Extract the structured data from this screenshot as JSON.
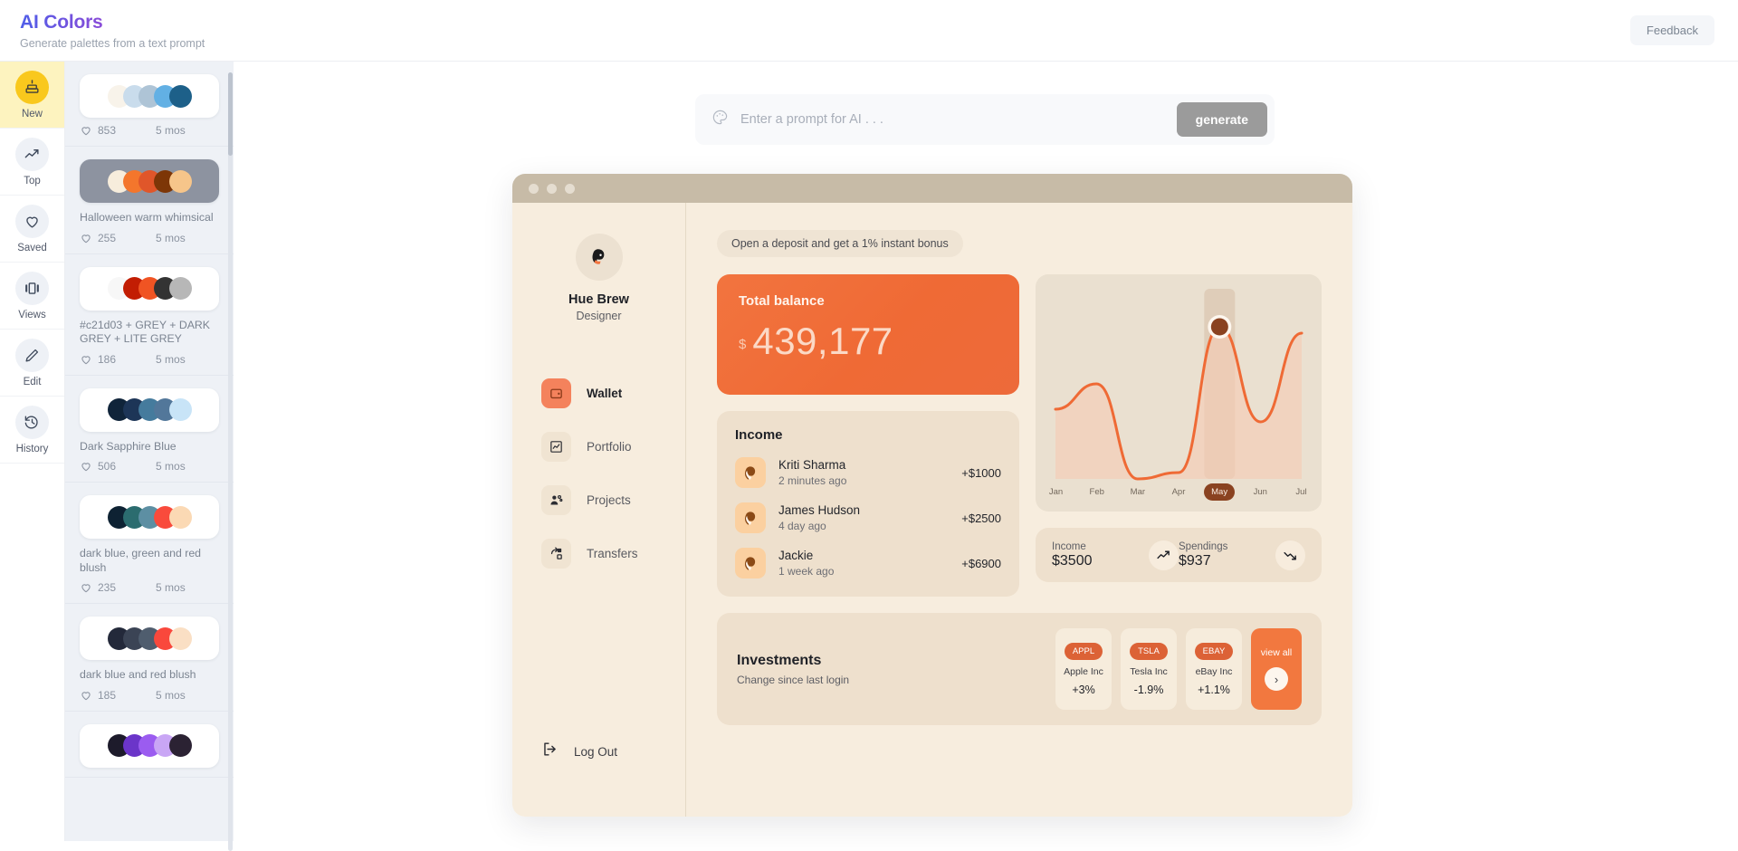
{
  "header": {
    "title": "AI Colors",
    "subtitle": "Generate palettes from a text prompt",
    "feedback_label": "Feedback"
  },
  "rail": {
    "items": [
      {
        "label": "New",
        "icon": "cake-icon",
        "active": true
      },
      {
        "label": "Top",
        "icon": "trending-up-icon",
        "active": false
      },
      {
        "label": "Saved",
        "icon": "heart-icon",
        "active": false
      },
      {
        "label": "Views",
        "icon": "carousel-icon",
        "active": false
      },
      {
        "label": "Edit",
        "icon": "pencil-icon",
        "active": false
      },
      {
        "label": "History",
        "icon": "history-icon",
        "active": false
      }
    ]
  },
  "palettes": {
    "items": [
      {
        "name": "",
        "likes": "853",
        "age": "5 mos",
        "card_dark": false,
        "colors": [
          "#f8f3ea",
          "#c9dcec",
          "#aec4d6",
          "#62b0e4",
          "#1d6089"
        ]
      },
      {
        "name": "Halloween warm whimsical",
        "likes": "255",
        "age": "5 mos",
        "card_dark": true,
        "colors": [
          "#f7eddc",
          "#f4762c",
          "#e0562a",
          "#7d3607",
          "#f6c58a"
        ]
      },
      {
        "name": "#c21d03 + GREY + DARK GREY + LITE GREY",
        "likes": "186",
        "age": "5 mos",
        "card_dark": false,
        "colors": [
          "#f7f7f7",
          "#c21d03",
          "#f05423",
          "#333333",
          "#b7b7b7"
        ]
      },
      {
        "name": "Dark Sapphire Blue",
        "likes": "506",
        "age": "5 mos",
        "card_dark": false,
        "colors": [
          "#10243a",
          "#1d3557",
          "#457b9d",
          "#52779a",
          "#c8e4f7"
        ]
      },
      {
        "name": "dark blue, green and red blush",
        "likes": "235",
        "age": "5 mos",
        "card_dark": false,
        "colors": [
          "#0e2233",
          "#2b6c6f",
          "#5d8fa3",
          "#f94b3c",
          "#fbd9b4"
        ]
      },
      {
        "name": "dark blue and red blush",
        "likes": "185",
        "age": "5 mos",
        "card_dark": false,
        "colors": [
          "#23293a",
          "#3b4455",
          "#4f5d6e",
          "#f9483c",
          "#fadfc4"
        ]
      },
      {
        "name": "",
        "likes": "",
        "age": "",
        "card_dark": false,
        "colors": [
          "#1d1b2b",
          "#6b35c9",
          "#9b5cf0",
          "#c9a6f5",
          "#2b2233"
        ]
      }
    ]
  },
  "prompt": {
    "placeholder": "Enter a prompt for AI . . .",
    "value": "",
    "icon": "palette-icon",
    "generate_label": "generate"
  },
  "preview": {
    "window_dots": 3,
    "user": {
      "name": "Hue Brew",
      "role": "Designer",
      "avatar": "user-avatar"
    },
    "nav": [
      {
        "label": "Wallet",
        "icon": "wallet-icon",
        "active": true
      },
      {
        "label": "Portfolio",
        "icon": "portfolio-icon",
        "active": false
      },
      {
        "label": "Projects",
        "icon": "projects-icon",
        "active": false
      },
      {
        "label": "Transfers",
        "icon": "transfers-icon",
        "active": false
      }
    ],
    "logout_label": "Log Out",
    "banner": "Open a deposit and get a 1% instant bonus",
    "balance": {
      "label": "Total balance",
      "currency": "$",
      "value": "439,177"
    },
    "income": {
      "title": "Income",
      "rows": [
        {
          "name": "Kriti Sharma",
          "time": "2 minutes ago",
          "amount": "+$1000"
        },
        {
          "name": "James Hudson",
          "time": "4 day ago",
          "amount": "+$2500"
        },
        {
          "name": "Jackie",
          "time": "1 week ago",
          "amount": "+$6900"
        }
      ]
    },
    "stats": [
      {
        "label": "Income",
        "value": "$3500",
        "icon": "trend-up-icon"
      },
      {
        "label": "Spendings",
        "value": "$937",
        "icon": "trend-down-icon"
      }
    ],
    "investments": {
      "title": "Investments",
      "subtitle": "Change since last login",
      "stocks": [
        {
          "ticker": "APPL",
          "name": "Apple Inc",
          "change": "+3%"
        },
        {
          "ticker": "TSLA",
          "name": "Tesla Inc",
          "change": "-1.9%"
        },
        {
          "ticker": "EBAY",
          "name": "eBay Inc",
          "change": "+1.1%"
        }
      ],
      "view_all_label": "view all"
    }
  },
  "chart_data": {
    "type": "area",
    "title": "",
    "categories": [
      "Jan",
      "Feb",
      "Mar",
      "Apr",
      "May",
      "Jun",
      "Jul"
    ],
    "values": [
      52,
      60,
      30,
      32,
      78,
      48,
      76
    ],
    "highlight": "May",
    "xlabel": "",
    "ylabel": "",
    "grid": false,
    "legend": "none",
    "line_color": "#ef6a35",
    "fill_color": "#f6cbb4"
  },
  "colors": {
    "accent_orange": "#f2743f",
    "brand_yellow": "#f9c81d",
    "preview_bg": "#f7edde",
    "card_bg": "#eee0cd"
  }
}
